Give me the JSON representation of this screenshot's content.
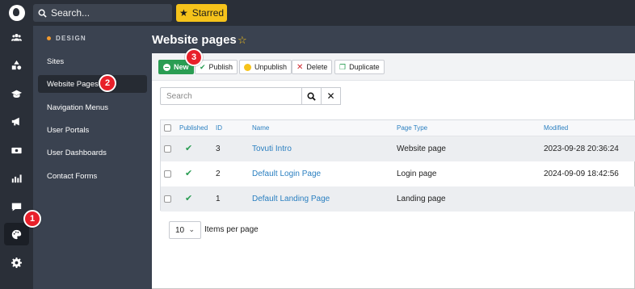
{
  "topbar": {
    "search_placeholder": "Search...",
    "starred_label": "Starred"
  },
  "rail": {
    "items": [
      {
        "icon": "users-icon"
      },
      {
        "icon": "shapes-icon"
      },
      {
        "icon": "graduation-cap-icon"
      },
      {
        "icon": "megaphone-icon"
      },
      {
        "icon": "money-icon"
      },
      {
        "icon": "analytics-icon"
      },
      {
        "icon": "chat-icon"
      },
      {
        "icon": "palette-icon",
        "active": true
      },
      {
        "icon": "gear-icon"
      }
    ]
  },
  "subnav": {
    "section_title": "DESIGN",
    "items": [
      {
        "label": "Sites"
      },
      {
        "label": "Website Pages",
        "active": true
      },
      {
        "label": "Navigation Menus"
      },
      {
        "label": "User Portals"
      },
      {
        "label": "User Dashboards"
      },
      {
        "label": "Contact Forms"
      }
    ]
  },
  "page": {
    "title": "Website pages"
  },
  "toolbar": {
    "new_label": "New",
    "publish_label": "Publish",
    "unpublish_label": "Unpublish",
    "delete_label": "Delete",
    "duplicate_label": "Duplicate"
  },
  "list_search": {
    "placeholder": "Search"
  },
  "table": {
    "headers": {
      "published": "Published",
      "id": "ID",
      "name": "Name",
      "page_type": "Page Type",
      "modified": "Modified"
    },
    "rows": [
      {
        "id": "3",
        "name": "Tovuti Intro",
        "page_type": "Website page",
        "modified": "2023-09-28 20:36:24"
      },
      {
        "id": "2",
        "name": "Default Login Page",
        "page_type": "Login page",
        "modified": "2024-09-09 18:42:56"
      },
      {
        "id": "1",
        "name": "Default Landing Page",
        "page_type": "Landing page",
        "modified": ""
      }
    ]
  },
  "pager": {
    "value": "10",
    "label": "Items per page"
  },
  "callouts": {
    "one": "1",
    "two": "2",
    "three": "3"
  },
  "colors": {
    "accent_green": "#2a9d53",
    "starred_yellow": "#f6c31b",
    "callout_red": "#e8202a",
    "link_blue": "#2a7fc0"
  }
}
